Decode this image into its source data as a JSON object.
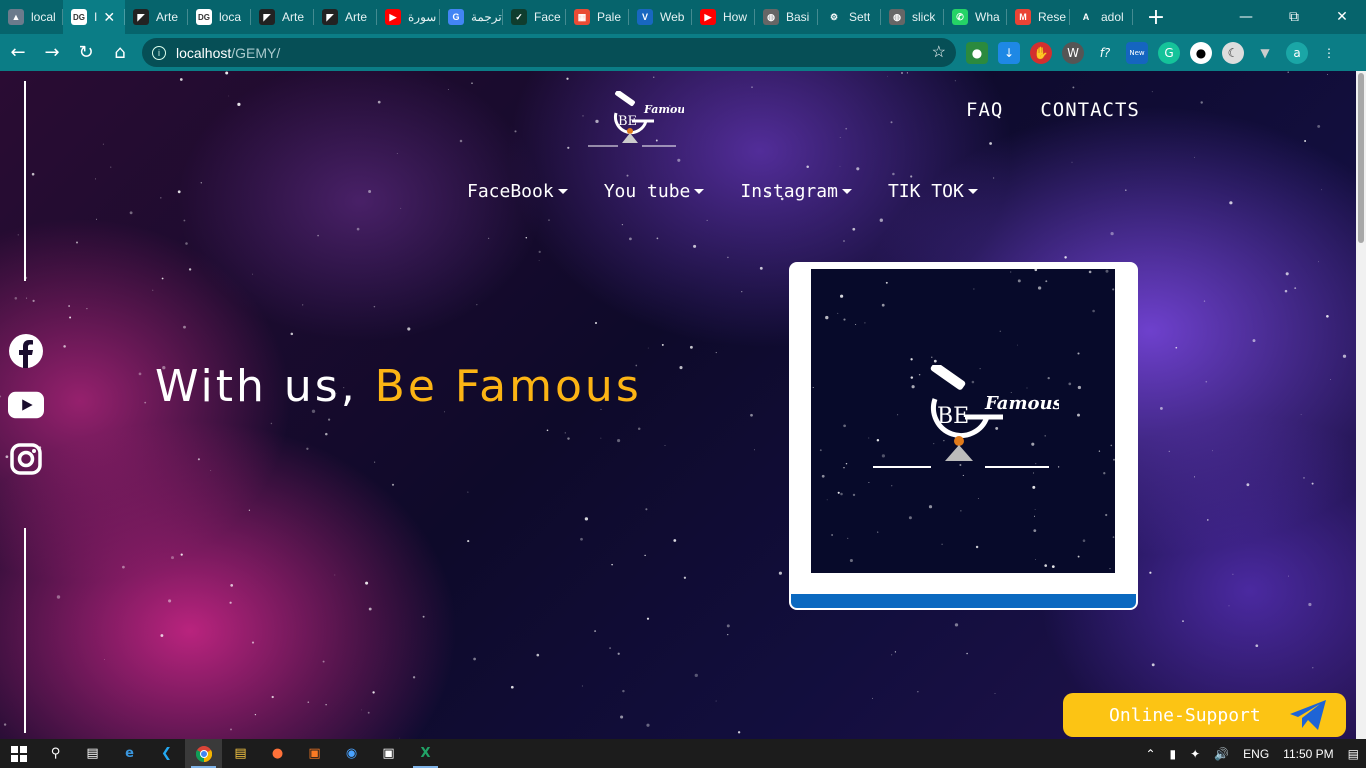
{
  "browser": {
    "tabs": [
      {
        "title": "local",
        "favicon": "mountain-icon",
        "color": "#6b7b8c",
        "active": false
      },
      {
        "title": "I",
        "favicon": "dg-icon",
        "color": "#ffffff",
        "active": true
      },
      {
        "title": "Arte",
        "favicon": "artem-icon",
        "color": "#222222",
        "active": false
      },
      {
        "title": "loca",
        "favicon": "dg-icon",
        "color": "#ffffff",
        "active": false
      },
      {
        "title": "Arte",
        "favicon": "artem-icon",
        "color": "#222222",
        "active": false
      },
      {
        "title": "Arte",
        "favicon": "artem-icon",
        "color": "#222222",
        "active": false
      },
      {
        "title": "سورة",
        "favicon": "youtube-icon",
        "color": "#ff0000",
        "active": false
      },
      {
        "title": "ترجمة",
        "favicon": "translate-icon",
        "color": "#4285f4",
        "active": false
      },
      {
        "title": "Face",
        "favicon": "check-icon",
        "color": "#0f3d2e",
        "active": false
      },
      {
        "title": "Pale",
        "favicon": "palette-icon",
        "color": "#e94b35",
        "active": false
      },
      {
        "title": "Web",
        "favicon": "vuetify-icon",
        "color": "#1867c0",
        "active": false
      },
      {
        "title": "How",
        "favicon": "youtube-icon",
        "color": "#ff0000",
        "active": false
      },
      {
        "title": "Basi",
        "favicon": "globe-icon",
        "color": "#666666",
        "active": false
      },
      {
        "title": "Sett",
        "favicon": "gear-icon",
        "color": "#ffffff",
        "active": false
      },
      {
        "title": "slick",
        "favicon": "globe-icon",
        "color": "#666666",
        "active": false
      },
      {
        "title": "Wha",
        "favicon": "whatsapp-icon",
        "color": "#25d366",
        "active": false
      },
      {
        "title": "Rese",
        "favicon": "gmail-icon",
        "color": "#ea4335",
        "active": false
      },
      {
        "title": "adol",
        "favicon": "adobe-icon",
        "color": "#ffffff",
        "active": false
      }
    ],
    "url_host": "localhost",
    "url_path": "/GEMY/"
  },
  "site": {
    "logo_be": "BE",
    "logo_famous": "Famous",
    "top_nav": [
      "FAQ",
      "CONTACTS"
    ],
    "menu": [
      "FaceBook",
      "You tube",
      "Instagram",
      "TIK TOK"
    ],
    "hero_prefix": "With us, ",
    "hero_accent": "Be Famous",
    "support_label": "Online-Support",
    "social": [
      "facebook-icon",
      "youtube-icon",
      "instagram-icon"
    ],
    "colors": {
      "accent": "#fcb414",
      "card_bar": "#0b69c0",
      "support_bg": "#fcc414"
    }
  },
  "taskbar": {
    "language": "ENG",
    "time": "11:50 PM"
  }
}
